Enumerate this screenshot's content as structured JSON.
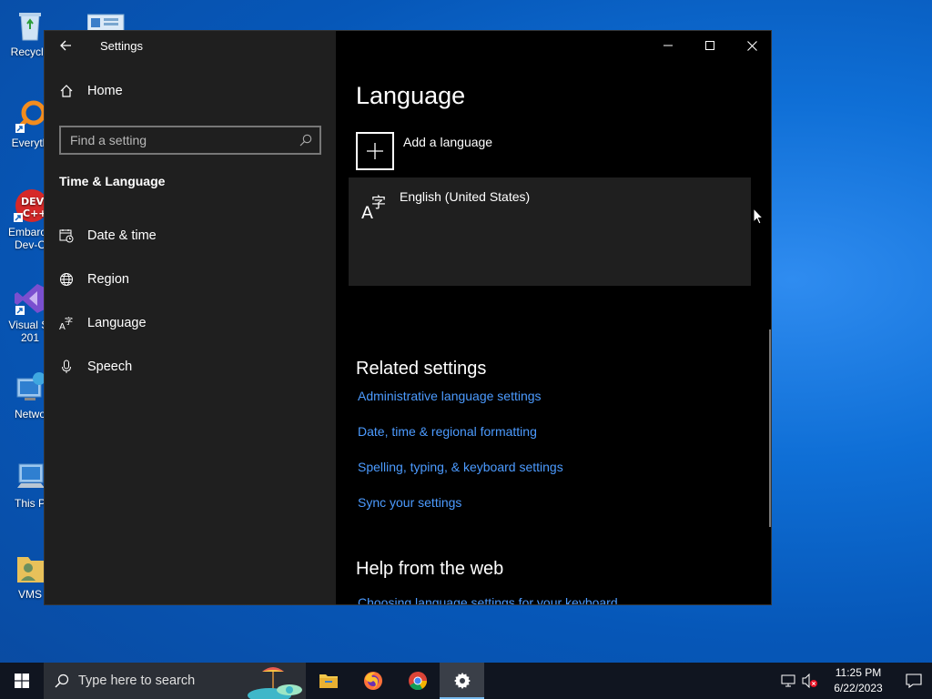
{
  "desktop": {
    "icons": [
      {
        "label": "Recycle",
        "name": "recycle-bin-icon"
      },
      {
        "label": "Everyth",
        "name": "everything-icon"
      },
      {
        "label": "Embarca",
        "label2": "Dev-C",
        "name": "devcpp-icon"
      },
      {
        "label": "Visual St",
        "label2": "201",
        "name": "visual-studio-icon"
      },
      {
        "label": "Netwo",
        "name": "network-icon"
      },
      {
        "label": "This P",
        "name": "this-pc-icon"
      },
      {
        "label": "VMS",
        "name": "vms-folder-icon"
      }
    ]
  },
  "window": {
    "title": "Settings",
    "sidebar": {
      "home_label": "Home",
      "search_placeholder": "Find a setting",
      "section_title": "Time & Language",
      "items": [
        {
          "label": "Date & time",
          "icon": "date-time-icon"
        },
        {
          "label": "Region",
          "icon": "globe-icon"
        },
        {
          "label": "Language",
          "icon": "language-icon"
        },
        {
          "label": "Speech",
          "icon": "microphone-icon"
        }
      ]
    },
    "content": {
      "page_title": "Language",
      "add_language_label": "Add a language",
      "languages": [
        {
          "name": "English (United States)"
        }
      ],
      "related_title": "Related settings",
      "related_links": [
        "Administrative language settings",
        "Date, time & regional formatting",
        "Spelling, typing, & keyboard settings",
        "Sync your settings"
      ],
      "help_title": "Help from the web",
      "help_links": [
        "Choosing language settings for your keyboard"
      ]
    }
  },
  "taskbar": {
    "search_placeholder": "Type here to search",
    "apps": [
      {
        "name": "file-explorer-icon"
      },
      {
        "name": "firefox-icon"
      },
      {
        "name": "chrome-icon"
      },
      {
        "name": "settings-gear-icon",
        "active": true
      }
    ],
    "clock_time": "11:25 PM",
    "clock_date": "6/22/2023"
  },
  "colors": {
    "accent_link": "#4c9bff",
    "sidebar_bg": "#1f1f1f",
    "content_bg": "#000000",
    "taskbar_bg": "#101520"
  }
}
